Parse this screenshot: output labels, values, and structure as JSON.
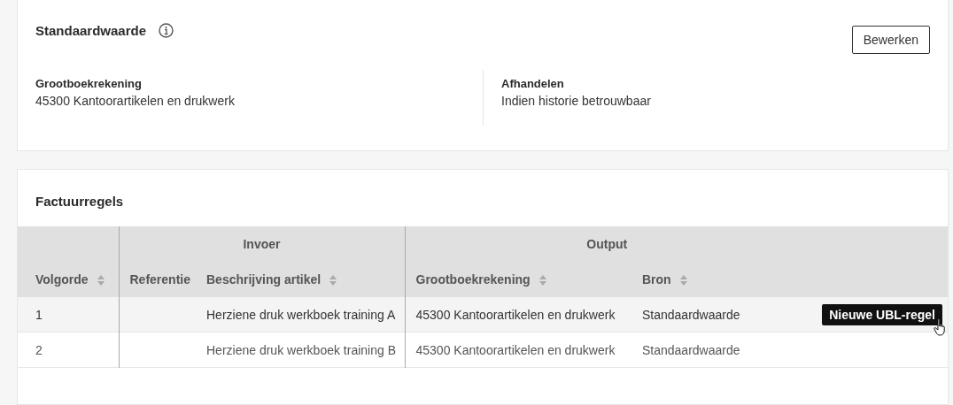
{
  "defaults": {
    "title": "Standaardwaarde",
    "edit_button": "Bewerken",
    "fields": [
      {
        "label": "Grootboekrekening",
        "value": "45300 Kantoorartikelen en drukwerk"
      },
      {
        "label": "Afhandelen",
        "value": "Indien historie betrouwbaar"
      }
    ]
  },
  "invoice_lines": {
    "title": "Factuurregels",
    "groups": [
      {
        "label": "Invoer"
      },
      {
        "label": "Output"
      }
    ],
    "columns": [
      {
        "label": "Volgorde",
        "sortable": true
      },
      {
        "label": "Referentie",
        "sortable": false
      },
      {
        "label": "Beschrijving artikel",
        "sortable": true
      },
      {
        "label": "Grootboekrekening",
        "sortable": true
      },
      {
        "label": "Bron",
        "sortable": true
      }
    ],
    "rows": [
      {
        "cells": [
          "1",
          "",
          "Herziene druk werkboek training A",
          "45300 Kantoorartikelen en drukwerk",
          "Standaardwaarde"
        ],
        "hovered": true,
        "action": "Nieuwe UBL-regel"
      },
      {
        "cells": [
          "2",
          "",
          "Herziene druk werkboek training B",
          "45300 Kantoorartikelen en drukwerk",
          "Standaardwaarde"
        ],
        "hovered": false
      }
    ]
  }
}
